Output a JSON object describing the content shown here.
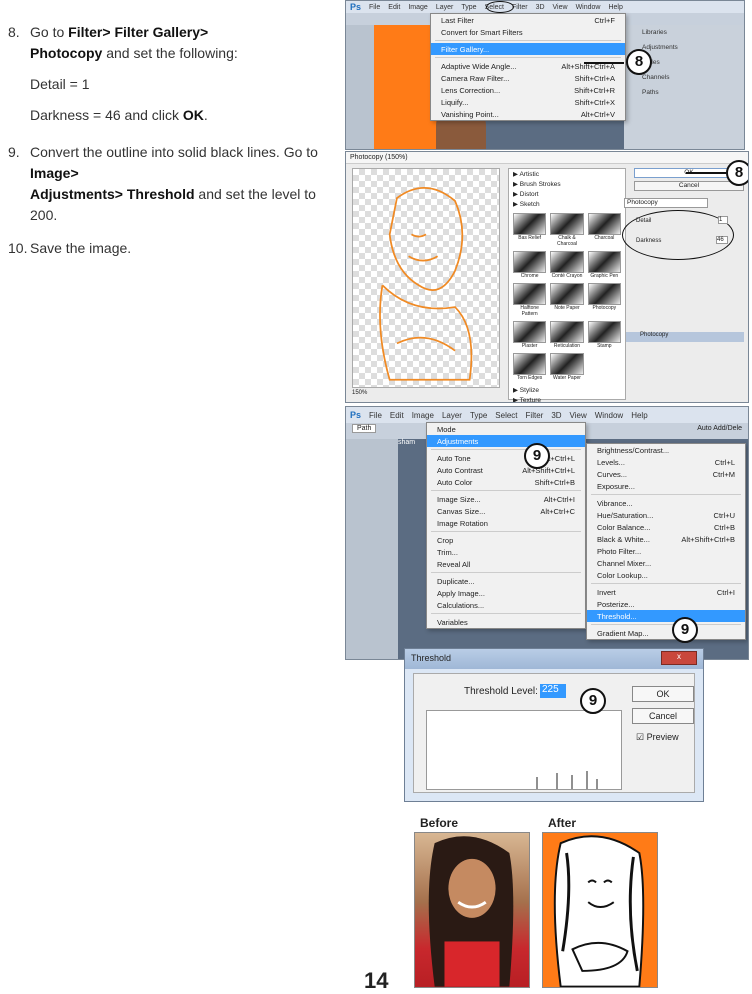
{
  "steps": {
    "s8_num": "8.",
    "s8_text_a": "Go to ",
    "s8_b1": "Filter",
    "s8_text_b": "> ",
    "s8_b2": "Filter Gallery",
    "s8_text_c": ">",
    "s8_b3": "Photocopy",
    "s8_text_d": " and set the following:",
    "detail": "Detail     = 1",
    "darkness_a": "Darkness = 46 and click ",
    "darkness_b": "OK",
    "darkness_c": ".",
    "s9_num": "9.",
    "s9_text_a": "Convert the outline into solid black lines. Go to ",
    "s9_b1": "Image",
    "s9_text_b": ">",
    "s9_b2": "Adjustments",
    "s9_text_c": "> ",
    "s9_b3": "Threshold",
    "s9_text_d": " and set the level to 200.",
    "s10_num": "10.",
    "s10_text": "Save the image."
  },
  "filter_menu": {
    "bar": [
      "Ps",
      "File",
      "Edit",
      "Image",
      "Layer",
      "Type",
      "Select",
      "Filter",
      "3D",
      "View",
      "Window",
      "Help"
    ],
    "items": [
      [
        "Last Filter",
        "Ctrl+F"
      ],
      [
        "Convert for Smart Filters",
        ""
      ],
      [
        "Filter Gallery...",
        ""
      ],
      [
        "Adaptive Wide Angle...",
        "Alt+Shift+Ctrl+A"
      ],
      [
        "Camera Raw Filter...",
        "Shift+Ctrl+A"
      ],
      [
        "Lens Correction...",
        "Shift+Ctrl+R"
      ],
      [
        "Liquify...",
        "Shift+Ctrl+X"
      ],
      [
        "Vanishing Point...",
        "Alt+Ctrl+V"
      ]
    ],
    "badge": "8",
    "panel": [
      "Libraries",
      "Adjustments",
      "Styles",
      "Channels",
      "Paths"
    ]
  },
  "gallery": {
    "title": "Photocopy (150%)",
    "folders": [
      "Artistic",
      "Brush Strokes",
      "Distort",
      "Sketch"
    ],
    "thumbs": [
      "Bas Relief",
      "Chalk & Charcoal",
      "Charcoal",
      "Chrome",
      "Conté Crayon",
      "Graphic Pen",
      "Halftone Pattern",
      "Note Paper",
      "Photocopy",
      "Plaster",
      "Reticulation",
      "Stamp",
      "Torn Edges",
      "Water Paper"
    ],
    "folders2": [
      "Stylize",
      "Texture"
    ],
    "ok": "OK",
    "cancel": "Cancel",
    "filter": "Photocopy",
    "detail_label": "Detail",
    "detail_val": "1",
    "dark_label": "Darkness",
    "dark_val": "46",
    "layer": "Photocopy",
    "zoom": "150%",
    "badge": "8"
  },
  "image_menu": {
    "bar": [
      "Ps",
      "File",
      "Edit",
      "Image",
      "Layer",
      "Type",
      "Select",
      "Filter",
      "3D",
      "View",
      "Window",
      "Help"
    ],
    "items": [
      [
        "Mode",
        ""
      ],
      [
        "Adjustments",
        ""
      ],
      [
        "Auto Tone",
        "Shift+Ctrl+L"
      ],
      [
        "Auto Contrast",
        "Alt+Shift+Ctrl+L"
      ],
      [
        "Auto Color",
        "Shift+Ctrl+B"
      ],
      [
        "Image Size...",
        "Alt+Ctrl+I"
      ],
      [
        "Canvas Size...",
        "Alt+Ctrl+C"
      ],
      [
        "Image Rotation",
        ""
      ],
      [
        "Crop",
        ""
      ],
      [
        "Trim...",
        ""
      ],
      [
        "Reveal All",
        ""
      ],
      [
        "Duplicate...",
        ""
      ],
      [
        "Apply Image...",
        ""
      ],
      [
        "Calculations...",
        ""
      ],
      [
        "Variables",
        ""
      ]
    ],
    "sub": [
      [
        "Brightness/Contrast...",
        ""
      ],
      [
        "Levels...",
        "Ctrl+L"
      ],
      [
        "Curves...",
        "Ctrl+M"
      ],
      [
        "Exposure...",
        ""
      ],
      [
        "Vibrance...",
        ""
      ],
      [
        "Hue/Saturation...",
        "Ctrl+U"
      ],
      [
        "Color Balance...",
        "Ctrl+B"
      ],
      [
        "Black & White...",
        "Alt+Shift+Ctrl+B"
      ],
      [
        "Photo Filter...",
        ""
      ],
      [
        "Channel Mixer...",
        ""
      ],
      [
        "Color Lookup...",
        ""
      ],
      [
        "Invert",
        "Ctrl+I"
      ],
      [
        "Posterize...",
        ""
      ],
      [
        "Threshold...",
        ""
      ],
      [
        "Gradient Map...",
        ""
      ]
    ],
    "path": "Path",
    "auto": "Auto Add/Dele",
    "doc": "sham",
    "badge": "9"
  },
  "threshold": {
    "title": "Threshold",
    "label": "Threshold Level:",
    "value": "225",
    "ok": "OK",
    "cancel": "Cancel",
    "preview": "Preview",
    "badge": "9",
    "close": "x"
  },
  "compare": {
    "before": "Before",
    "after": "After"
  },
  "page_num": "14"
}
